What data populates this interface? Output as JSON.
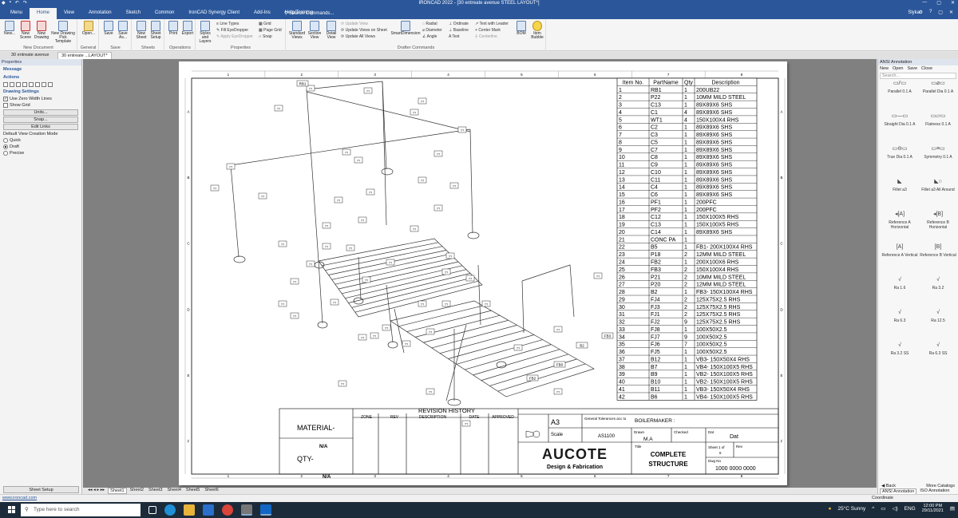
{
  "window": {
    "title": "IRONCAD 2022 - [30 entreate avenue STEEL LAYOUT*]",
    "user": "Slyka"
  },
  "menu": {
    "tabs": [
      "Menu",
      "Home",
      "View",
      "Annotation",
      "Sketch",
      "Common",
      "IronCAD Synergy Client",
      "Add-Ins",
      "Help/Training"
    ],
    "active": "Home",
    "search_placeholder": "Search Commands..."
  },
  "ribbon": {
    "groups": {
      "new_document": "New Document",
      "general": "General",
      "save": "Save",
      "sheets": "Sheets",
      "operations": "Operations",
      "properties": "Properties",
      "drafter_commands": "Drafter Commands"
    },
    "buttons": {
      "new": "New...",
      "new_scene": "New Scene",
      "new_drawing": "New Drawing",
      "new_drawing_pick": "New Drawing Pick Template",
      "open": "Open...",
      "save": "Save",
      "save_as": "Save As...",
      "new_sheet": "New Sheet",
      "sheet_setup": "Sheet Setup",
      "print": "Print",
      "export": "Export",
      "styles_layers": "Styles and Layers",
      "line_types": "Line Types",
      "eyedropper": "Fill EyeDropper",
      "apply_eyedropper": "Apply EyeDropper",
      "grid": "Grid",
      "page_grid": "Page Grid",
      "snap": "Snap",
      "standard_views": "Standard Views",
      "section_view": "Section View",
      "detail_view": "Detail View",
      "update_view": "Update View",
      "update_views_sheet": "Update Views on Sheet",
      "update_all_views": "Update All Views",
      "smart_dimension": "SmartDimension",
      "radial": "Radial",
      "diameter": "Diameter",
      "angle": "Angle",
      "ordinate": "Ordinate",
      "baseline": "Baseline",
      "text": "Text",
      "text_leader": "Text with Leader",
      "center_mark": "Center Mark",
      "centerline": "Centerline",
      "bom": "BOM",
      "item_bubble": "Item Bubble"
    }
  },
  "doc_tabs": [
    "30 entreate avenue",
    "30 entreate ...LAYOUT*"
  ],
  "left_panel": {
    "title": "Properties",
    "message": "Message",
    "actions": "Actions",
    "drawing_settings": "Drawing Settings",
    "use_zero_width": "Use Zero Width Lines",
    "show_grid": "Show Grid",
    "units": "Units...",
    "snap": "Snap...",
    "edit_links": "Edit Links",
    "view_mode_label": "Default View Creation Mode",
    "modes": [
      "Quick",
      "Draft",
      "Precise"
    ],
    "selected_mode": "Draft",
    "sheet_setup": "Sheet Setup"
  },
  "right_panel": {
    "title": "ANSI Annotation",
    "toolbar": [
      "New",
      "Open",
      "Save",
      "Close"
    ],
    "search": "Search...",
    "items": [
      "Parallel 0.1 A",
      "Parallel Dia 0.1 A",
      "Straight Dia 0.1 A",
      "Flatness 0.1 A",
      "True Dia 0.1 A",
      "Symmetry 0.1 A",
      "Fillet a3",
      "Fillet a3 All Around",
      "Reference A Horizontal",
      "Reference B Horizontal",
      "Reference A Vertical",
      "Reference B Vertical",
      "Ra 1.6",
      "Ra 3.2",
      "Ra 6.3",
      "Ra 12.5",
      "Ra 3.2 SS",
      "Ra 6.3 SS"
    ],
    "back": "Back",
    "more": "More Catalogs",
    "tabs": [
      "ANSI Annotation",
      "ISO Annotation"
    ]
  },
  "sheet_tabs": [
    "Sheet1",
    "Sheet2",
    "Sheet3",
    "Sheet4",
    "Sheet5",
    "Sheet6"
  ],
  "active_sheet": "Sheet1",
  "status": {
    "link": "www.ironcad.com",
    "coordinate": "Coordinate"
  },
  "drawing": {
    "col_labels": [
      "1",
      "2",
      "3",
      "4",
      "5",
      "6",
      "7",
      "8"
    ],
    "row_labels": [
      "A",
      "B",
      "C",
      "D",
      "E",
      "F"
    ],
    "bom_headers": [
      "Item No.",
      "PartName",
      "Qty",
      "Description"
    ],
    "bom": [
      [
        "1",
        "RB1",
        "1",
        "200UB22"
      ],
      [
        "2",
        "P22",
        "1",
        "10MM MILD STEEL"
      ],
      [
        "3",
        "C13",
        "1",
        "89X89X6 SHS"
      ],
      [
        "4",
        "C1",
        "4",
        "89X89X6 SHS"
      ],
      [
        "5",
        "WT1",
        "4",
        "150X100X4 RHS"
      ],
      [
        "6",
        "C2",
        "1",
        "89X89X6 SHS"
      ],
      [
        "7",
        "C3",
        "1",
        "89X89X6 SHS"
      ],
      [
        "8",
        "C5",
        "1",
        "89X89X6 SHS"
      ],
      [
        "9",
        "C7",
        "1",
        "89X89X6 SHS"
      ],
      [
        "10",
        "C8",
        "1",
        "89X89X6 SHS"
      ],
      [
        "11",
        "C9",
        "1",
        "89X89X6 SHS"
      ],
      [
        "12",
        "C10",
        "1",
        "89X89X6 SHS"
      ],
      [
        "13",
        "C11",
        "1",
        "89X89X6 SHS"
      ],
      [
        "14",
        "C4",
        "1",
        "89X89X6 SHS"
      ],
      [
        "15",
        "C6",
        "1",
        "89X89X6 SHS"
      ],
      [
        "16",
        "PF1",
        "1",
        "200PFC"
      ],
      [
        "17",
        "PF2",
        "1",
        "200PFC"
      ],
      [
        "18",
        "C12",
        "1",
        "150X100X5 RHS"
      ],
      [
        "19",
        "C13",
        "1",
        "150X100X5 RHS"
      ],
      [
        "20",
        "C14",
        "1",
        "89X89X6 SHS"
      ],
      [
        "21",
        "CONC PA",
        "1",
        ""
      ],
      [
        "22",
        "B5",
        "1",
        "FB1- 200X100X4 RHS"
      ],
      [
        "23",
        "P18",
        "2",
        "12MM MILD STEEL"
      ],
      [
        "24",
        "FB2",
        "1",
        "200X100X6 RHS"
      ],
      [
        "25",
        "FB3",
        "2",
        "150X100X4 RHS"
      ],
      [
        "26",
        "P21",
        "2",
        "10MM MILD STEEL"
      ],
      [
        "27",
        "P20",
        "2",
        "12MM  MILD STEEL"
      ],
      [
        "28",
        "B2",
        "1",
        "FB3- 150X100X4 RHS"
      ],
      [
        "29",
        "FJ4",
        "2",
        "125X75X2.5 RHS"
      ],
      [
        "30",
        "FJ3",
        "2",
        "125X75X2.5 RHS"
      ],
      [
        "31",
        "FJ1",
        "2",
        "125X75X2.5 RHS"
      ],
      [
        "32",
        "FJ2",
        "9",
        "125X75X2.5 RHS"
      ],
      [
        "33",
        "FJ8",
        "1",
        "100X50X2.5"
      ],
      [
        "34",
        "FJ7",
        "9",
        "100X50X2.5"
      ],
      [
        "35",
        "FJ6",
        "7",
        "100X50X2.5"
      ],
      [
        "36",
        "FJ5",
        "1",
        "100X50X2.5"
      ],
      [
        "37",
        "B12",
        "1",
        "VB3- 150X50X4 RHS"
      ],
      [
        "38",
        "B7",
        "1",
        "VB4- 150X100X5 RHS"
      ],
      [
        "39",
        "B9",
        "1",
        "VB2- 150X100X5 RHS"
      ],
      [
        "40",
        "B10",
        "1",
        "VB2- 150X100X5 RHS"
      ],
      [
        "41",
        "B11",
        "1",
        "VB3- 150X50X4 RHS"
      ],
      [
        "42",
        "B6",
        "1",
        "VB4- 150X100X5 RHS"
      ]
    ],
    "callouts": {
      "rb1": "RB1",
      "fb3": "FB3",
      "b2": "B2",
      "fb0": "FB0",
      "fb2": "FB2",
      "q": "??"
    },
    "title_block": {
      "material_label": "MATERIAL-",
      "material_value": "N/A",
      "qty_label": "QTY-",
      "qty_value": "N/A",
      "revision_history": "REVISION HISTORY",
      "rev_cols": [
        "ZONE",
        "REV",
        "DESCRIPTION",
        "DATE",
        "APPROVED"
      ],
      "size": "A3",
      "general_tol": "General Tolerances acc to",
      "client": "BOILERMAKER :",
      "scale_label": "Scale",
      "standard": "AS1100",
      "drawn_label": "Drawn",
      "drawn_value": "M.A",
      "checked_label": "Checked",
      "date_label": "Dat",
      "date_value": "Dat",
      "company": "AUCOTE",
      "company_sub": "Design & Fabrication",
      "title_label": "Title",
      "title1": "COMPLETE",
      "title2": "STRUCTURE",
      "sheet_label": "Sheet 1 of",
      "sheet_num": "6",
      "rev_label": "Rev",
      "dwg_label": "Dwg No",
      "dwg_no": "1000 0000 0000"
    }
  },
  "taskbar": {
    "search_placeholder": "Type here to search",
    "weather": "25°C  Sunny",
    "lang": "ENG",
    "time": "12:00 PM",
    "date": "29/11/2021"
  },
  "colors": {
    "accent": "#2b579a",
    "taskbar": "#1c2b3a",
    "company": "#1a1a1a"
  }
}
